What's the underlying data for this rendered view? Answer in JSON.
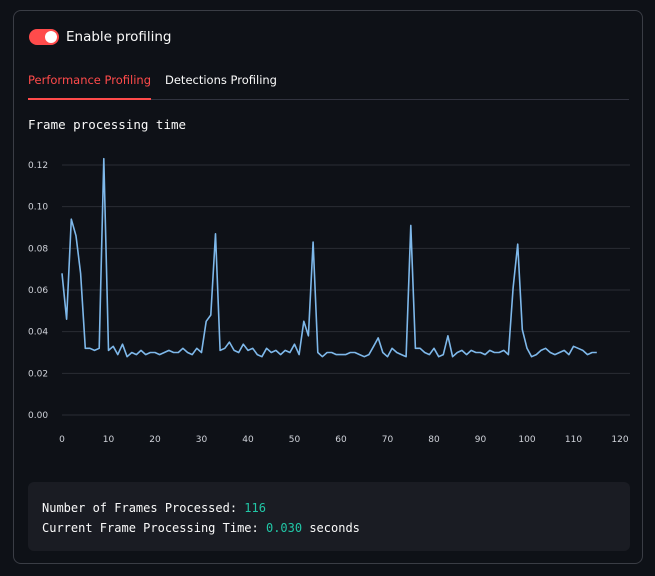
{
  "toggle": {
    "label": "Enable profiling",
    "on": true
  },
  "tabs": [
    {
      "label": "Performance Profiling",
      "active": true
    },
    {
      "label": "Detections Profiling",
      "active": false
    }
  ],
  "chart_title": "Frame processing time",
  "stats": {
    "frames_label": "Number of Frames Processed: ",
    "frames_value": "116",
    "time_label": "Current Frame Processing Time: ",
    "time_value": "0.030",
    "time_unit": " seconds"
  },
  "colors": {
    "accent": "#ff4b4b",
    "line": "#7eb8ea",
    "value": "#21c6a6"
  },
  "chart_data": {
    "type": "line",
    "title": "",
    "xlabel": "",
    "ylabel": "",
    "xlim": [
      0,
      120
    ],
    "ylim": [
      0,
      0.12
    ],
    "xticks": [
      0,
      10,
      20,
      30,
      40,
      50,
      60,
      70,
      80,
      90,
      100,
      110,
      120
    ],
    "yticks": [
      "0.00",
      "0.02",
      "0.04",
      "0.06",
      "0.08",
      "0.10",
      "0.12"
    ],
    "grid": true,
    "series": [
      {
        "values": [
          0.068,
          0.046,
          0.094,
          0.086,
          0.068,
          0.032,
          0.032,
          0.031,
          0.032,
          0.123,
          0.031,
          0.033,
          0.029,
          0.034,
          0.028,
          0.03,
          0.029,
          0.031,
          0.029,
          0.03,
          0.03,
          0.029,
          0.03,
          0.031,
          0.03,
          0.03,
          0.032,
          0.03,
          0.029,
          0.032,
          0.03,
          0.045,
          0.048,
          0.087,
          0.031,
          0.032,
          0.035,
          0.031,
          0.03,
          0.034,
          0.031,
          0.032,
          0.029,
          0.028,
          0.032,
          0.03,
          0.031,
          0.029,
          0.031,
          0.03,
          0.034,
          0.029,
          0.045,
          0.038,
          0.083,
          0.03,
          0.028,
          0.03,
          0.03,
          0.029,
          0.029,
          0.029,
          0.03,
          0.03,
          0.029,
          0.028,
          0.029,
          0.033,
          0.037,
          0.03,
          0.028,
          0.032,
          0.03,
          0.029,
          0.028,
          0.091,
          0.032,
          0.032,
          0.03,
          0.029,
          0.032,
          0.028,
          0.029,
          0.038,
          0.028,
          0.03,
          0.031,
          0.029,
          0.031,
          0.03,
          0.03,
          0.029,
          0.031,
          0.03,
          0.03,
          0.031,
          0.029,
          0.061,
          0.082,
          0.041,
          0.032,
          0.028,
          0.029,
          0.031,
          0.032,
          0.03,
          0.029,
          0.03,
          0.031,
          0.029,
          0.033,
          0.032,
          0.031,
          0.029,
          0.03,
          0.03
        ]
      }
    ]
  }
}
